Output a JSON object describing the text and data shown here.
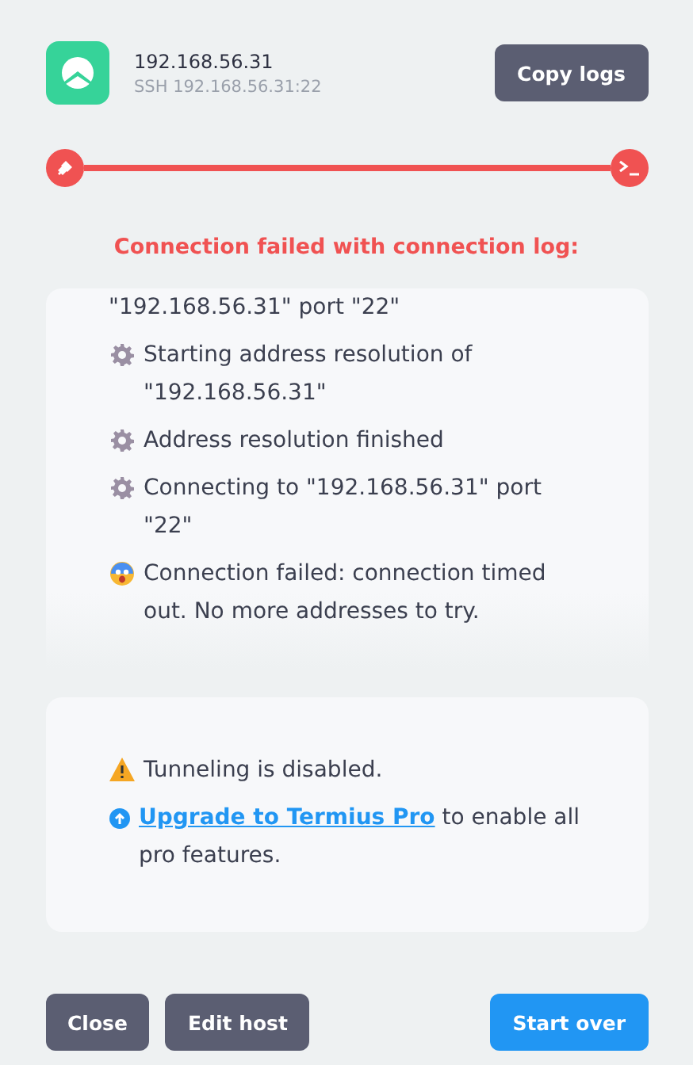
{
  "host": {
    "name": "192.168.56.31",
    "address": "SSH 192.168.56.31:22"
  },
  "copy_button": "Copy logs",
  "progress": {
    "failed": true
  },
  "status_message": "Connection failed with connection log:",
  "log": [
    {
      "kind": "continuation",
      "text": "\"192.168.56.31\" port \"22\""
    },
    {
      "kind": "info",
      "text": "Starting address resolution of \"192.168.56.31\""
    },
    {
      "kind": "info",
      "text": "Address resolution finished"
    },
    {
      "kind": "info",
      "text": "Connecting to \"192.168.56.31\" port \"22\""
    },
    {
      "kind": "error",
      "text": "Connection failed: connection timed out. No more addresses to try."
    }
  ],
  "notice": {
    "warning": "Tunneling is disabled.",
    "link": "Upgrade to Termius Pro",
    "rest": " to enable all pro features."
  },
  "buttons": [
    {
      "label": "Close",
      "kind": "secondary"
    },
    {
      "label": "Edit host",
      "kind": "secondary"
    },
    {
      "label": "Start over",
      "kind": "primary"
    }
  ]
}
